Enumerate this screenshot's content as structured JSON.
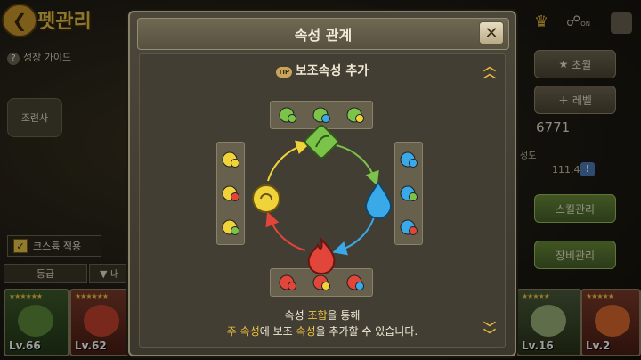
{
  "background": {
    "title": "펫관리",
    "guide": "성장 가이드",
    "trainer": "조련사",
    "costume": "코스튬 적용",
    "sort": "등급",
    "sort2": "내",
    "right": {
      "btn1": "초월",
      "btn2": "레벨",
      "score": "6771",
      "growth_label": "성도",
      "growth_value": "111.4",
      "skill_btn": "스킬관리",
      "equip_btn": "장비관리",
      "on": "ON"
    },
    "cards": [
      {
        "level": "Lv.66"
      },
      {
        "level": "Lv.62"
      },
      {
        "level": "Lv.16"
      },
      {
        "level": "Lv.2"
      }
    ]
  },
  "modal": {
    "title": "속성 관계",
    "section_title": "보조속성 추가",
    "tip_label": "TIP",
    "caption_line1_pre": "속성 ",
    "caption_line1_hl": "조합",
    "caption_line1_post": "을 통해",
    "caption_line2_pre": "주 속성",
    "caption_line2_mid": "에 보조 ",
    "caption_line2_hl": "속성",
    "caption_line2_post": "을 추가할 수 있습니다."
  },
  "elements": {
    "colors": {
      "grass": "#7cc34a",
      "water": "#3aa9e8",
      "fire": "#e2463a",
      "light": "#f0d23a"
    },
    "cycle": [
      "grass",
      "water",
      "fire",
      "light"
    ],
    "top_combos": [
      [
        "grass",
        "grass"
      ],
      [
        "grass",
        "water"
      ],
      [
        "grass",
        "light"
      ]
    ],
    "right_combos": [
      [
        "water",
        "water"
      ],
      [
        "water",
        "grass"
      ],
      [
        "water",
        "fire"
      ]
    ],
    "bottom_combos": [
      [
        "fire",
        "fire"
      ],
      [
        "fire",
        "light"
      ],
      [
        "fire",
        "water"
      ]
    ],
    "left_combos": [
      [
        "light",
        "light"
      ],
      [
        "light",
        "fire"
      ],
      [
        "light",
        "grass"
      ]
    ]
  }
}
